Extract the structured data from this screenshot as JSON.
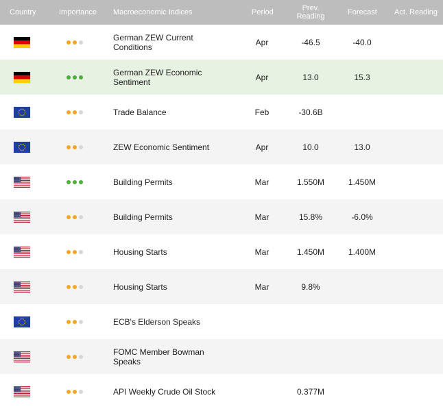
{
  "header": {
    "country": "Country",
    "importance": "Importance",
    "indices": "Macroeconomic Indices",
    "period": "Period",
    "prev_line1": "Prev.",
    "prev_line2": "Reading",
    "forecast": "Forecast",
    "actual": "Act. Reading"
  },
  "colors": {
    "header_bg": "#bdbdbd",
    "alt_row": "#f4f4f4",
    "highlight_row": "#e8f2e2",
    "importance_orange": "#f5a623",
    "importance_green": "#4caf3a",
    "importance_inactive": "#d6d6d6"
  },
  "rows": [
    {
      "country": "Germany",
      "flag_icon": "germany-flag-icon",
      "importance": 2,
      "importance_color": "orange",
      "name": "German ZEW Current Conditions",
      "period": "Apr",
      "prev": "-46.5",
      "forecast": "-40.0",
      "actual": ""
    },
    {
      "country": "Germany",
      "flag_icon": "germany-flag-icon",
      "importance": 3,
      "importance_color": "green",
      "highlight": true,
      "name": "German ZEW Economic Sentiment",
      "period": "Apr",
      "prev": "13.0",
      "forecast": "15.3",
      "actual": ""
    },
    {
      "country": "Euro Zone",
      "flag_icon": "eu-flag-icon",
      "importance": 2,
      "importance_color": "orange",
      "name": "Trade Balance",
      "period": "Feb",
      "prev": "-30.6B",
      "forecast": "",
      "actual": ""
    },
    {
      "country": "Euro Zone",
      "flag_icon": "eu-flag-icon",
      "importance": 2,
      "importance_color": "orange",
      "name": "ZEW Economic Sentiment",
      "period": "Apr",
      "prev": "10.0",
      "forecast": "13.0",
      "actual": ""
    },
    {
      "country": "United States",
      "flag_icon": "us-flag-icon",
      "importance": 3,
      "importance_color": "green",
      "name": "Building Permits",
      "period": "Mar",
      "prev": "1.550M",
      "forecast": "1.450M",
      "actual": ""
    },
    {
      "country": "United States",
      "flag_icon": "us-flag-icon",
      "importance": 2,
      "importance_color": "orange",
      "name": "Building Permits",
      "period": "Mar",
      "prev": "15.8%",
      "forecast": "-6.0%",
      "actual": ""
    },
    {
      "country": "United States",
      "flag_icon": "us-flag-icon",
      "importance": 2,
      "importance_color": "orange",
      "name": "Housing Starts",
      "period": "Mar",
      "prev": "1.450M",
      "forecast": "1.400M",
      "actual": ""
    },
    {
      "country": "United States",
      "flag_icon": "us-flag-icon",
      "importance": 2,
      "importance_color": "orange",
      "name": "Housing Starts",
      "period": "Mar",
      "prev": "9.8%",
      "forecast": "",
      "actual": ""
    },
    {
      "country": "Euro Zone",
      "flag_icon": "eu-flag-icon",
      "importance": 2,
      "importance_color": "orange",
      "name": "ECB's Elderson Speaks",
      "period": "",
      "prev": "",
      "forecast": "",
      "actual": ""
    },
    {
      "country": "United States",
      "flag_icon": "us-flag-icon",
      "importance": 2,
      "importance_color": "orange",
      "name": "FOMC Member Bowman Speaks",
      "period": "",
      "prev": "",
      "forecast": "",
      "actual": ""
    },
    {
      "country": "United States",
      "flag_icon": "us-flag-icon",
      "importance": 2,
      "importance_color": "orange",
      "name": "API Weekly Crude Oil Stock",
      "period": "",
      "prev": "0.377M",
      "forecast": "",
      "actual": ""
    }
  ]
}
